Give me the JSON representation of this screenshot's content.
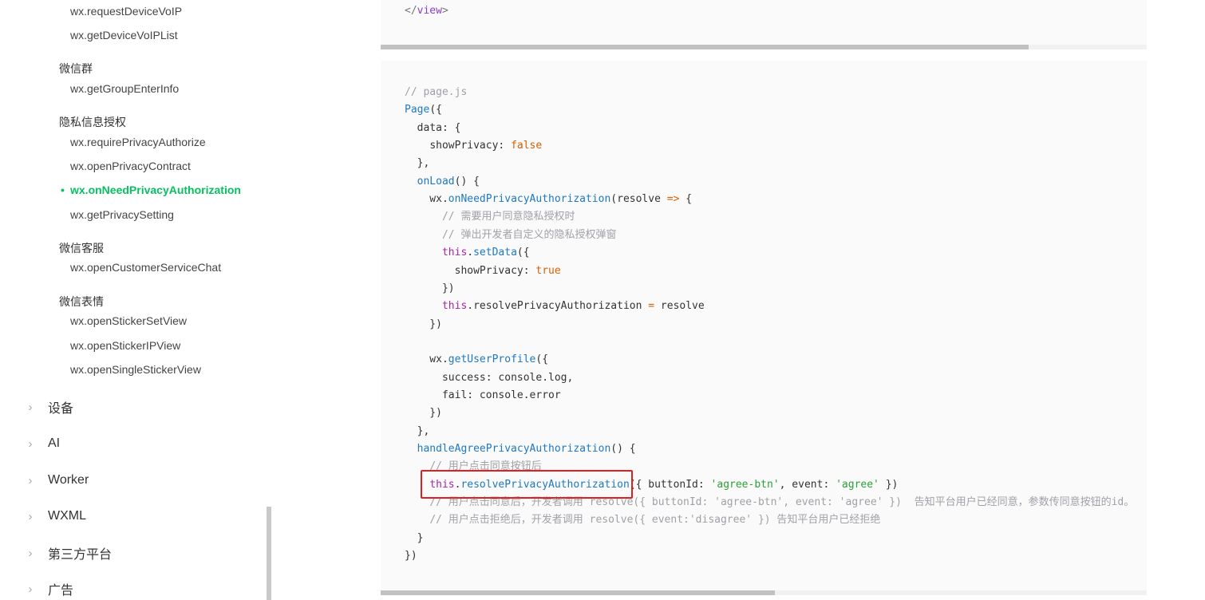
{
  "sidebar": {
    "top_items": [
      {
        "label": "wx.requestDeviceVoIP"
      },
      {
        "label": "wx.getDeviceVoIPList"
      }
    ],
    "groups": [
      {
        "title": "微信群",
        "items": [
          "wx.getGroupEnterInfo"
        ]
      },
      {
        "title": "隐私信息授权",
        "items": [
          "wx.requirePrivacyAuthorize",
          "wx.openPrivacyContract",
          "wx.onNeedPrivacyAuthorization",
          "wx.getPrivacySetting"
        ]
      },
      {
        "title": "微信客服",
        "items": [
          "wx.openCustomerServiceChat"
        ]
      },
      {
        "title": "微信表情",
        "items": [
          "wx.openStickerSetView",
          "wx.openStickerIPView",
          "wx.openSingleStickerView"
        ]
      }
    ],
    "active_item": "wx.onNeedPrivacyAuthorization",
    "active_marker": "•",
    "categories": [
      "设备",
      "AI",
      "Worker",
      "WXML",
      "第三方平台",
      "广告"
    ],
    "chevron": "›"
  },
  "code_top": {
    "line": "</view>"
  },
  "code_main": {
    "lines": [
      "// page.js",
      "Page({",
      "  data: {",
      "    showPrivacy: false",
      "  },",
      "  onLoad() {",
      "    wx.onNeedPrivacyAuthorization(resolve => {",
      "      // 需要用户同意隐私授权时",
      "      // 弹出开发者自定义的隐私授权弹窗",
      "      this.setData({",
      "        showPrivacy: true",
      "      })",
      "      this.resolvePrivacyAuthorization = resolve",
      "    })",
      "",
      "    wx.getUserProfile({",
      "      success: console.log,",
      "      fail: console.error",
      "    })",
      "  },",
      "  handleAgreePrivacyAuthorization() {",
      "    // 用户点击同意按钮后",
      "    this.resolvePrivacyAuthorization({ buttonId: 'agree-btn', event: 'agree' })",
      "    // 用户点击同意后，开发者调用 resolve({ buttonId: 'agree-btn', event: 'agree' })  告知平台用户已经同意，参数传同意按钮的id。",
      "    // 用户点击拒绝后，开发者调用 resolve({ event:'disagree' }) 告知平台用户已经拒绝",
      "  }",
      "})"
    ]
  },
  "colors": {
    "accent": "#07c160",
    "highlight_border": "#e02020",
    "code_bg": "#fafafa"
  }
}
